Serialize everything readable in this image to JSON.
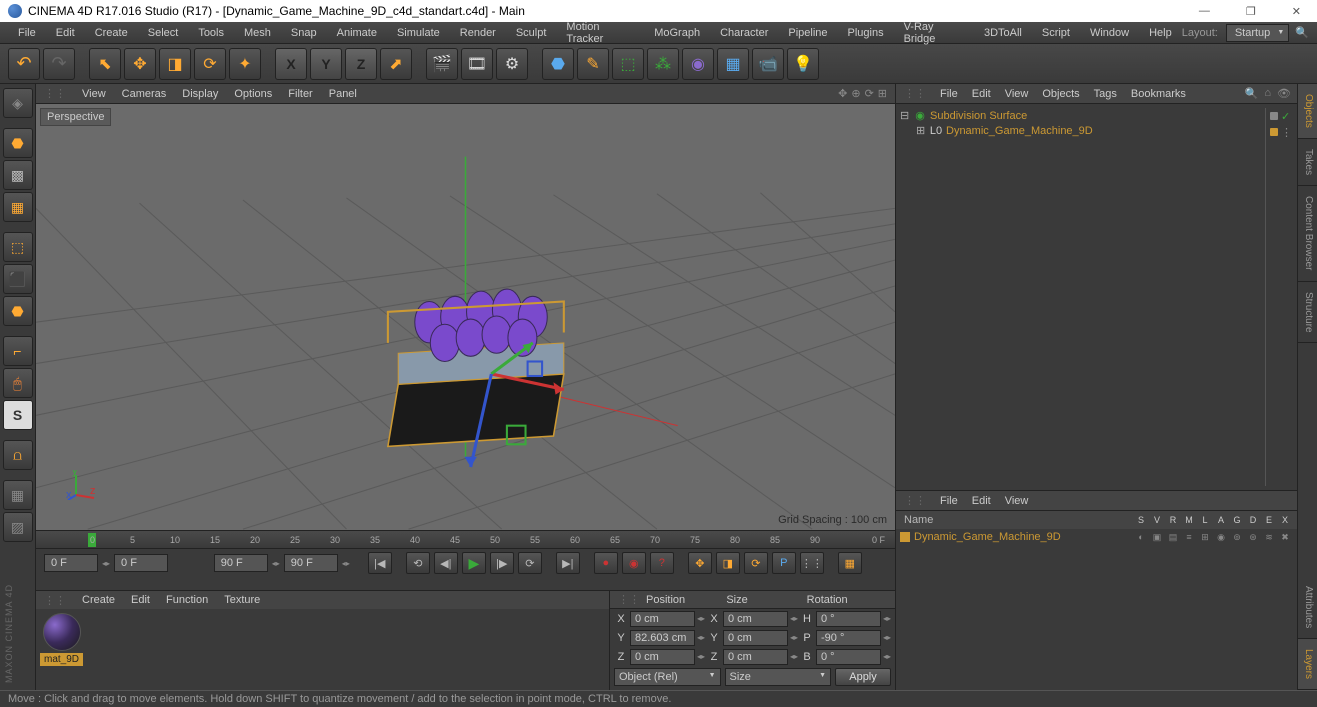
{
  "titlebar": {
    "text": "CINEMA 4D R17.016 Studio (R17) - [Dynamic_Game_Machine_9D_c4d_standart.c4d] - Main"
  },
  "menubar": {
    "items": [
      "File",
      "Edit",
      "Create",
      "Select",
      "Tools",
      "Mesh",
      "Snap",
      "Animate",
      "Simulate",
      "Render",
      "Sculpt",
      "Motion Tracker",
      "MoGraph",
      "Character",
      "Pipeline",
      "Plugins",
      "V-Ray Bridge",
      "3DToAll",
      "Script",
      "Window",
      "Help"
    ],
    "layout_label": "Layout:",
    "layout_value": "Startup"
  },
  "viewport_menu": {
    "items": [
      "View",
      "Cameras",
      "Display",
      "Options",
      "Filter",
      "Panel"
    ],
    "label": "Perspective",
    "grid_spacing": "Grid Spacing : 100 cm"
  },
  "timeline": {
    "start": "0 F",
    "range_start": "0 F",
    "range_end": "90 F",
    "current": "90 F",
    "end_label": "0 F",
    "ticks": [
      "0",
      "5",
      "10",
      "15",
      "20",
      "25",
      "30",
      "35",
      "40",
      "45",
      "50",
      "55",
      "60",
      "65",
      "70",
      "75",
      "80",
      "85",
      "90"
    ]
  },
  "material": {
    "menu": [
      "Create",
      "Edit",
      "Function",
      "Texture"
    ],
    "name": "mat_9D"
  },
  "coord": {
    "headers": [
      "Position",
      "Size",
      "Rotation"
    ],
    "rows": [
      {
        "axis": "X",
        "pos": "0 cm",
        "saxis": "X",
        "size": "0 cm",
        "raxis": "H",
        "rot": "0 °"
      },
      {
        "axis": "Y",
        "pos": "82.603 cm",
        "saxis": "Y",
        "size": "0 cm",
        "raxis": "P",
        "rot": "-90 °"
      },
      {
        "axis": "Z",
        "pos": "0 cm",
        "saxis": "Z",
        "size": "0 cm",
        "raxis": "B",
        "rot": "0 °"
      }
    ],
    "mode1": "Object (Rel)",
    "mode2": "Size",
    "apply": "Apply"
  },
  "objects_panel": {
    "menu": [
      "File",
      "Edit",
      "View",
      "Objects",
      "Tags",
      "Bookmarks"
    ],
    "tree": [
      {
        "name": "Subdivision Surface",
        "level": 0,
        "icon": "subdiv"
      },
      {
        "name": "Dynamic_Game_Machine_9D",
        "level": 1,
        "icon": "null"
      }
    ]
  },
  "layers_panel": {
    "menu": [
      "File",
      "Edit",
      "View"
    ],
    "name_header": "Name",
    "cols": [
      "S",
      "V",
      "R",
      "M",
      "L",
      "A",
      "G",
      "D",
      "E",
      "X"
    ],
    "items": [
      {
        "name": "Dynamic_Game_Machine_9D"
      }
    ]
  },
  "right_tabs": [
    "Objects",
    "Takes",
    "Content Browser",
    "Structure",
    "Attributes",
    "Layers"
  ],
  "statusbar": {
    "text": "Move : Click and drag to move elements. Hold down SHIFT to quantize movement / add to the selection in point mode, CTRL to remove."
  },
  "maxon": "MAXON  CINEMA 4D"
}
